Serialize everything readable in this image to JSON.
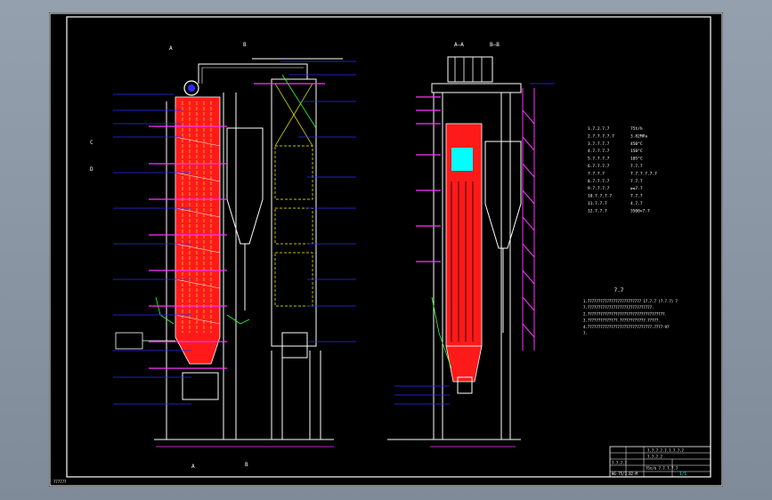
{
  "colors": {
    "background": "#000000",
    "border": "#ffffff",
    "furnace_fill": "#ff1a1a",
    "platform": "#ff33ff",
    "leader": "#2b2bff",
    "steel": "#ffffff",
    "flue": "#ffff00",
    "pipe_green": "#33ff33",
    "cyan": "#00ffff"
  },
  "section_labels": {
    "top_left_a": "A",
    "top_left_b": "B",
    "bottom_left_a": "A",
    "bottom_left_b": "B",
    "side_c": "C",
    "side_d": "D",
    "side_view_aa": "A—A",
    "side_view_bb": "B—B"
  },
  "spec_table": {
    "rows": [
      {
        "key": "1.7.2.7.7",
        "value": "75t/h"
      },
      {
        "key": "2.7.7.7.7.7",
        "value": "3.82MPa"
      },
      {
        "key": "3.7.7.7.7",
        "value": "450°C"
      },
      {
        "key": "4.7.7.7.7",
        "value": "150°C"
      },
      {
        "key": "5.7.7.7.7",
        "value": "105°C"
      },
      {
        "key": "6.7.7.7.7",
        "value": "7.7.7"
      },
      {
        "key": "7.7.7.7",
        "value": "7.7.7.7.7.7"
      },
      {
        "key": "8.7.7.7.7",
        "value": "7.7.7"
      },
      {
        "key": "9.7.7.7.7",
        "value": "≥≤7.7"
      },
      {
        "key": "10.7.7.7.7",
        "value": "7.7.7"
      },
      {
        "key": "11.7.7.7",
        "value": "4.7.7"
      },
      {
        "key": "12.7.7.7",
        "value": "3500×7.7"
      }
    ]
  },
  "notes": {
    "title": "7.7",
    "lines": [
      "1.7777777777777777777777777 17.7.7 (7.7.7) 7",
      "  7.777777777777777777777777777777.",
      "2.777777777777777777777777777777777777.",
      "3.77777777777777.777777777777.77777.",
      "4.777777777777777777777777777777.7777-97",
      "  7."
    ]
  },
  "title_block": {
    "rows": [
      "7.7.7.7.7.7.7.7.7",
      "7.7.7.7",
      "7.7.7.7",
      "75t/h 7.7.7.7.7",
      "HG-75/3.82-M"
    ],
    "sheet_number": "1/1"
  },
  "bottom_left_stamp": "777777"
}
